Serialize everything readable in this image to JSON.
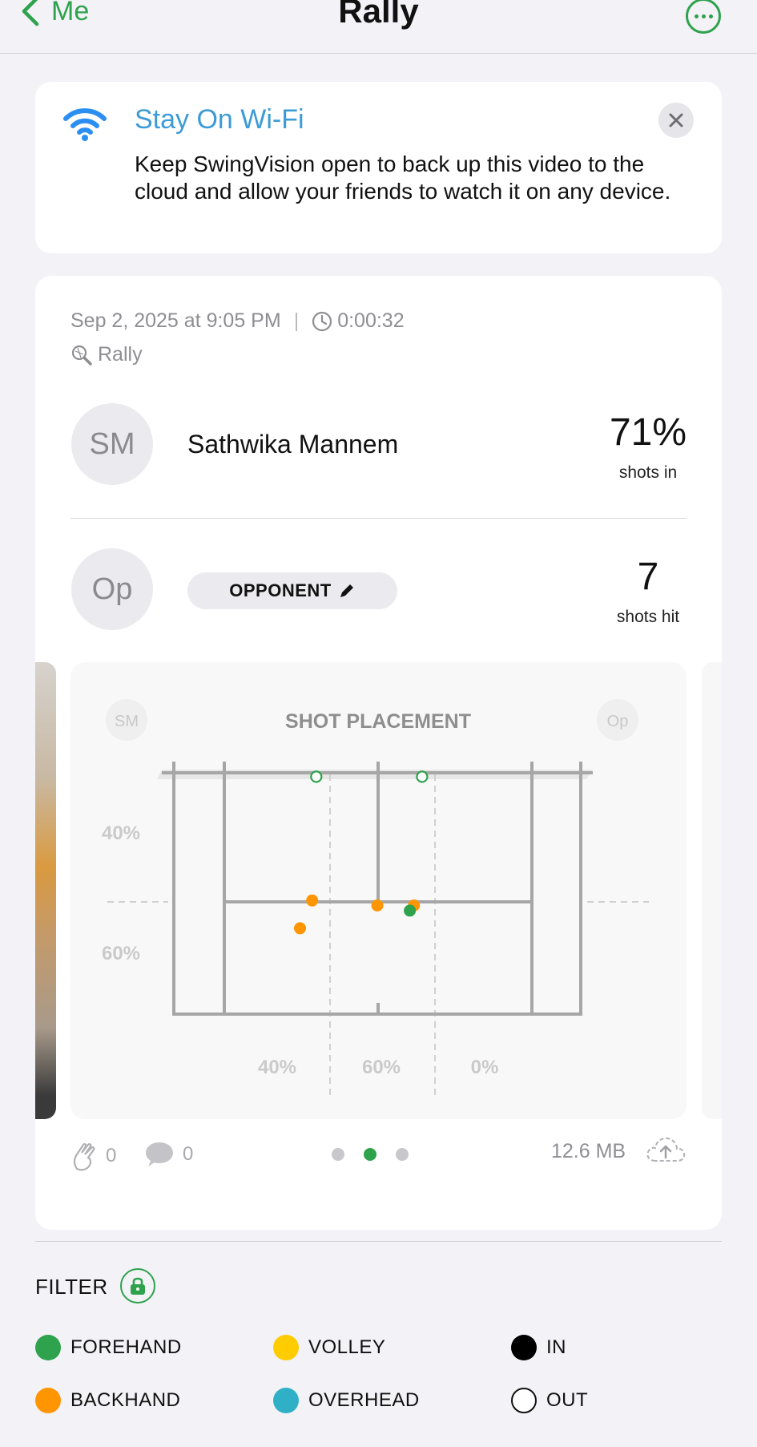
{
  "nav": {
    "back_label": "Me",
    "title": "Rally"
  },
  "wifi_banner": {
    "title": "Stay On Wi-Fi",
    "body": "Keep SwingVision open to back up this video to the cloud and allow your friends to watch it on any device."
  },
  "session": {
    "date": "Sep 2, 2025 at 9:05 PM",
    "duration": "0:00:32",
    "type": "Rally"
  },
  "players": [
    {
      "initials": "SM",
      "name": "Sathwika Mannem",
      "stat_value": "71%",
      "stat_label": "shots in"
    },
    {
      "initials": "Op",
      "name": "OPPONENT",
      "stat_value": "7",
      "stat_label": "shots hit"
    }
  ],
  "shot_placement": {
    "title": "SHOT PLACEMENT",
    "left_badge": "SM",
    "right_badge": "Op",
    "depth_labels": [
      "40%",
      "60%"
    ],
    "width_labels": [
      "40%",
      "60%",
      "0%"
    ]
  },
  "chart_data": {
    "type": "scatter",
    "title": "SHOT PLACEMENT",
    "xlabel": "",
    "ylabel": "",
    "depth_percentages": [
      40,
      60
    ],
    "width_percentages": [
      40,
      60,
      0
    ],
    "series": [
      {
        "name": "BACKHAND",
        "color": "#ff9500",
        "outcome": "IN",
        "points": [
          {
            "x": 0.34,
            "y": 0.55
          },
          {
            "x": 0.31,
            "y": 0.66
          },
          {
            "x": 0.5,
            "y": 0.57
          },
          {
            "x": 0.59,
            "y": 0.57
          }
        ]
      },
      {
        "name": "FOREHAND",
        "color": "#2ea24c",
        "outcome": "IN",
        "points": [
          {
            "x": 0.58,
            "y": 0.59
          }
        ]
      },
      {
        "name": "FOREHAND",
        "color": "#2ea24c",
        "outcome": "OUT",
        "points": [
          {
            "x": 0.35,
            "y": 0.06
          },
          {
            "x": 0.61,
            "y": 0.06
          }
        ]
      }
    ]
  },
  "footer": {
    "claps": "0",
    "comments": "0",
    "file_size": "12.6 MB",
    "page_count": 3,
    "active_page": 1
  },
  "filter": {
    "label": "FILTER",
    "items": [
      {
        "label": "FOREHAND",
        "color": "#2ea24c"
      },
      {
        "label": "VOLLEY",
        "color": "#ffcc00"
      },
      {
        "label": "IN",
        "color": "#000000"
      },
      {
        "label": "BACKHAND",
        "color": "#ff9500"
      },
      {
        "label": "OVERHEAD",
        "color": "#30b0c7"
      },
      {
        "label": "OUT",
        "color": "#ffffff"
      }
    ]
  },
  "colors": {
    "accent": "#2ea24c",
    "wifi_blue": "#3d9bd6"
  },
  "icons": [
    "chevron-left-icon",
    "more-icon",
    "wifi-icon",
    "close-icon",
    "clock-icon",
    "racket-icon",
    "pencil-icon",
    "clap-icon",
    "comment-icon",
    "cloud-upload-icon",
    "lock-icon"
  ]
}
